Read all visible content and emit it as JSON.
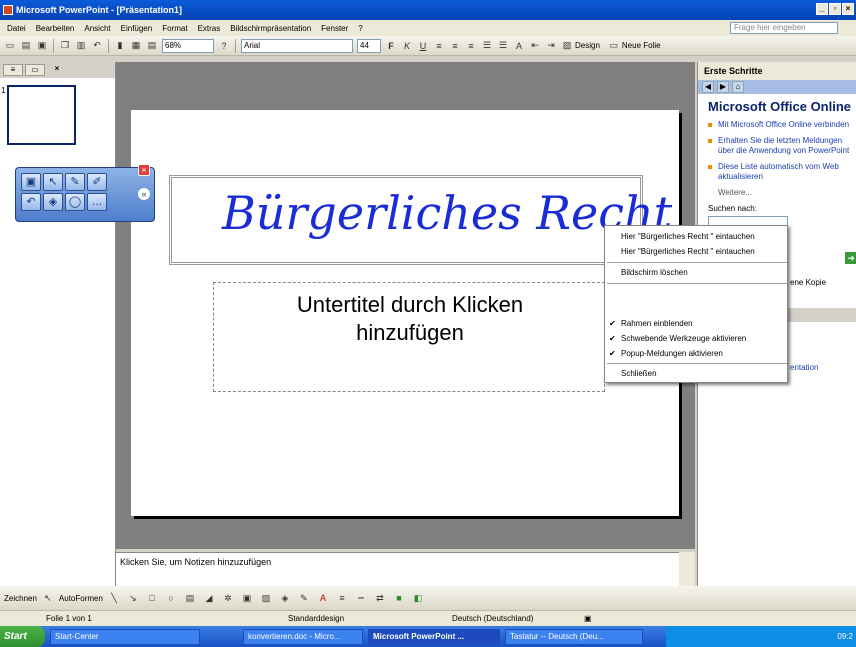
{
  "window": {
    "title": "Microsoft PowerPoint - [Präsentation1]"
  },
  "menubar": {
    "items": [
      "Datei",
      "Bearbeiten",
      "Ansicht",
      "Einfügen",
      "Format",
      "Extras",
      "Bildschirmpräsentation",
      "Fenster",
      "?"
    ],
    "ask_placeholder": "Frage hier eingeben"
  },
  "toolbar": {
    "zoom": "68%",
    "font": "Arial",
    "size": "44",
    "design_label": "Design",
    "newslide_label": "Neue Folie"
  },
  "left_panel": {
    "slide_number": "1"
  },
  "slide": {
    "title": "Bürgerliches Recht",
    "subtitle_line1": "Untertitel durch Klicken",
    "subtitle_line2": "hinzufügen"
  },
  "notes": {
    "placeholder": "Klicken Sie, um Notizen hinzuzufügen"
  },
  "task_pane": {
    "header": "Erste Schritte",
    "title": "Microsoft Office Online",
    "links": [
      "Mit Microsoft Office Online verbinden",
      "Erhalten Sie die letzten Meldungen über die Anwendung von PowerPoint",
      "Diese Liste automatisch vom Web aktualisieren"
    ],
    "more": "Weitere...",
    "search_label": "Suchen nach:",
    "partial_text_1": "ene Kopie",
    "partial_text_2": "entation"
  },
  "context_menu": {
    "items": [
      "Hier \"Bürgerliches Recht \" eintauchen",
      "Hier \"Bürgerliches Recht \" eintauchen",
      "Bildschirm löschen",
      "Rahmen einblenden",
      "Schwebende Werkzeuge aktivieren",
      "Popup-Meldungen aktivieren",
      "Schließen"
    ]
  },
  "drawbar": {
    "draw_label": "Zeichnen",
    "autoshapes_label": "AutoFormen"
  },
  "statusbar": {
    "slide": "Folie 1 von 1",
    "design": "Standarddesign",
    "language": "Deutsch (Deutschland)"
  },
  "taskbar": {
    "start": "Start",
    "tasks": [
      "Start-Center",
      "konvertieren.doc - Micro...",
      "Microsoft PowerPoint ...",
      "Tastatur -- Deutsch (Deu..."
    ],
    "clock": "09:2"
  }
}
